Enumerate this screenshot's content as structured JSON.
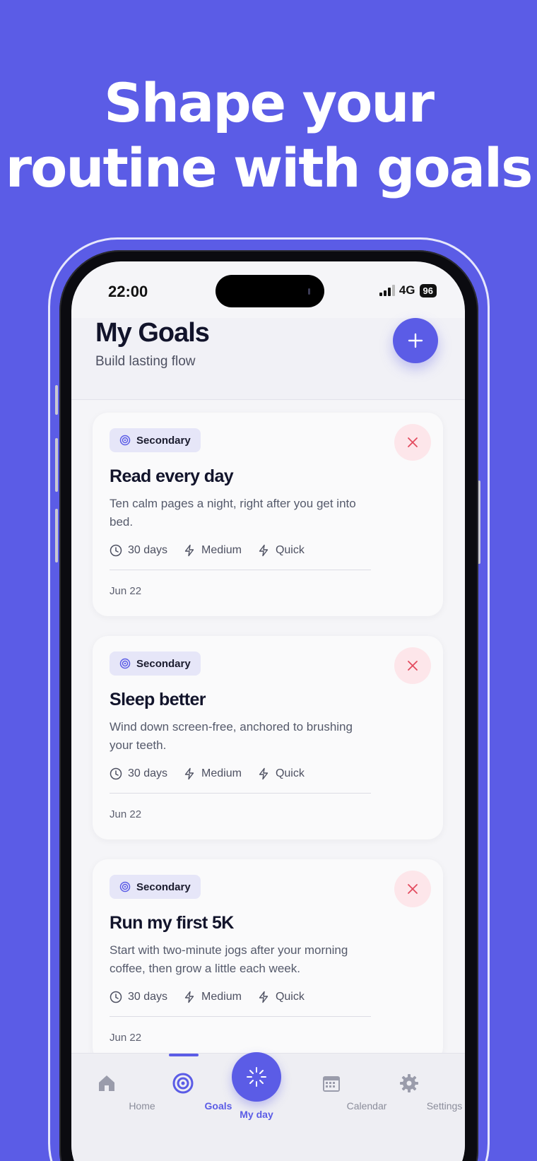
{
  "headline": {
    "line1": "Shape your",
    "line2": "routine with goals"
  },
  "status_bar": {
    "time": "22:00",
    "network": "4G",
    "battery": "96"
  },
  "header": {
    "title": "My Goals",
    "subtitle": "Build lasting flow"
  },
  "goals": [
    {
      "tag": "Secondary",
      "title": "Read every day",
      "description": "Ten calm pages a night, right after you get into bed.",
      "duration": "30 days",
      "difficulty": "Medium",
      "effort": "Quick",
      "date": "Jun 22"
    },
    {
      "tag": "Secondary",
      "title": "Sleep better",
      "description": "Wind down screen-free, anchored to brushing your teeth.",
      "duration": "30 days",
      "difficulty": "Medium",
      "effort": "Quick",
      "date": "Jun 22"
    },
    {
      "tag": "Secondary",
      "title": "Run my first 5K",
      "description": "Start with two-minute jogs after your morning coffee, then grow a little each week.",
      "duration": "30 days",
      "difficulty": "Medium",
      "effort": "Quick",
      "date": "Jun 22"
    }
  ],
  "nav": {
    "home": "Home",
    "goals": "Goals",
    "my_day": "My day",
    "calendar": "Calendar",
    "settings": "Settings",
    "active": "Goals"
  },
  "colors": {
    "accent": "#5b5ce6",
    "background": "#5b5ce6",
    "danger": "#e34b5e",
    "danger_bg": "#fde6ea",
    "chip_bg": "#e6e6f8"
  },
  "icons": {
    "add": "plus-icon",
    "remove": "close-icon",
    "tag": "target-icon",
    "duration": "clock-icon",
    "difficulty": "bolt-icon",
    "effort": "bolt-icon"
  }
}
